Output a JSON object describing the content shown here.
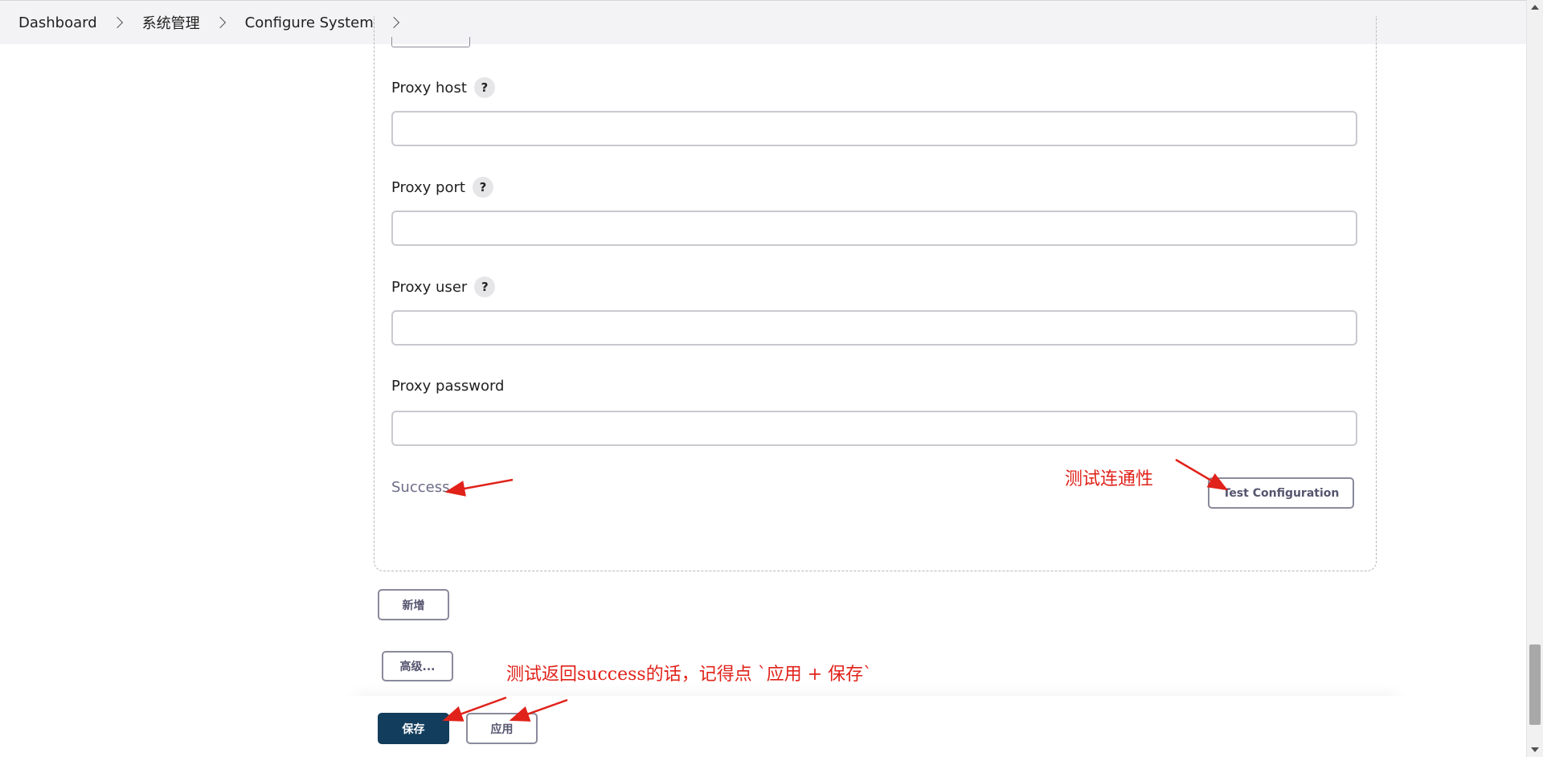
{
  "breadcrumb": [
    {
      "label": "Dashboard"
    },
    {
      "label": "系统管理"
    },
    {
      "label": "Configure System"
    }
  ],
  "fields": {
    "proxy_host": {
      "label": "Proxy host",
      "help": "?",
      "value": ""
    },
    "proxy_port": {
      "label": "Proxy port",
      "help": "?",
      "value": ""
    },
    "proxy_user": {
      "label": "Proxy user",
      "help": "?",
      "value": ""
    },
    "proxy_password": {
      "label": "Proxy password",
      "value": ""
    }
  },
  "status": {
    "text": "Success"
  },
  "buttons": {
    "test_configuration": "Test Configuration",
    "add": "新增",
    "advanced": "高级...",
    "save": "保存",
    "apply": "应用"
  },
  "annotations": {
    "test_connectivity": "测试连通性",
    "save_hint": "测试返回success的话，记得点 `应用 + 保存`",
    "color": "#e0221a"
  },
  "colors": {
    "primary_button": "#133d5c",
    "success_text": "#6b6b86",
    "topbar_bg": "#f3f3f5"
  }
}
